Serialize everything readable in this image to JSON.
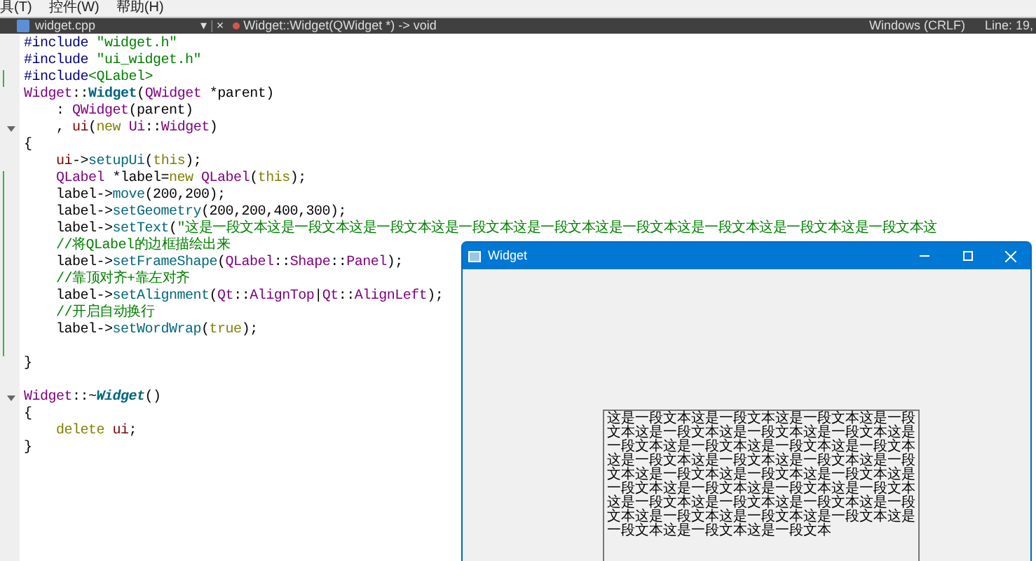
{
  "menu": [
    "具(T)",
    "控件(W)",
    "帮助(H)"
  ],
  "toolbar": {
    "file": "widget.cpp",
    "caret": "▾",
    "separator": "|",
    "close": "×",
    "function": "Widget::Widget(QWidget *) -> void",
    "line_ending": "Windows (CRLF)",
    "position": "Line: 19,"
  },
  "code": [
    {
      "changed": false,
      "fold": false,
      "tokens": [
        {
          "kind": "pre",
          "text": "#include "
        },
        {
          "kind": "str",
          "text": "\"widget.h\""
        }
      ]
    },
    {
      "changed": false,
      "fold": false,
      "tokens": [
        {
          "kind": "pre",
          "text": "#include "
        },
        {
          "kind": "str",
          "text": "\"ui_widget.h\""
        }
      ]
    },
    {
      "changed": true,
      "fold": false,
      "tokens": [
        {
          "kind": "pre",
          "text": "#include"
        },
        {
          "kind": "str",
          "text": "<QLabel>"
        }
      ]
    },
    {
      "changed": false,
      "fold": false,
      "tokens": [
        {
          "kind": "type",
          "text": "Widget"
        },
        {
          "kind": "plain",
          "text": "::"
        },
        {
          "kind": "fn",
          "text": "Widget"
        },
        {
          "kind": "plain",
          "text": "("
        },
        {
          "kind": "type",
          "text": "QWidget"
        },
        {
          "kind": "plain",
          "text": " *parent)"
        }
      ]
    },
    {
      "changed": false,
      "fold": false,
      "tokens": [
        {
          "kind": "plain",
          "text": "    : "
        },
        {
          "kind": "type",
          "text": "QWidget"
        },
        {
          "kind": "plain",
          "text": "(parent)"
        }
      ]
    },
    {
      "changed": false,
      "fold": true,
      "tokens": [
        {
          "kind": "plain",
          "text": "    , "
        },
        {
          "kind": "member",
          "text": "ui"
        },
        {
          "kind": "plain",
          "text": "("
        },
        {
          "kind": "kw",
          "text": "new"
        },
        {
          "kind": "type",
          "text": " Ui"
        },
        {
          "kind": "plain",
          "text": "::"
        },
        {
          "kind": "type",
          "text": "Widget"
        },
        {
          "kind": "plain",
          "text": ")"
        }
      ]
    },
    {
      "changed": false,
      "fold": false,
      "tokens": [
        {
          "kind": "plain",
          "text": "{"
        }
      ]
    },
    {
      "changed": false,
      "fold": false,
      "tokens": [
        {
          "kind": "member",
          "text": "    ui"
        },
        {
          "kind": "plain",
          "text": "->"
        },
        {
          "kind": "method",
          "text": "setupUi"
        },
        {
          "kind": "plain",
          "text": "("
        },
        {
          "kind": "kw",
          "text": "this"
        },
        {
          "kind": "plain",
          "text": ");"
        }
      ]
    },
    {
      "changed": true,
      "fold": false,
      "tokens": [
        {
          "kind": "type",
          "text": "    QLabel"
        },
        {
          "kind": "plain",
          "text": " *label="
        },
        {
          "kind": "kw",
          "text": "new"
        },
        {
          "kind": "type",
          "text": " QLabel"
        },
        {
          "kind": "plain",
          "text": "("
        },
        {
          "kind": "kw",
          "text": "this"
        },
        {
          "kind": "plain",
          "text": ");"
        }
      ]
    },
    {
      "changed": true,
      "fold": false,
      "tokens": [
        {
          "kind": "plain",
          "text": "    label->"
        },
        {
          "kind": "method",
          "text": "move"
        },
        {
          "kind": "plain",
          "text": "(200,200);"
        }
      ]
    },
    {
      "changed": true,
      "fold": false,
      "tokens": [
        {
          "kind": "plain",
          "text": "    label->"
        },
        {
          "kind": "method",
          "text": "setGeometry"
        },
        {
          "kind": "plain",
          "text": "(200,200,400,300);"
        }
      ]
    },
    {
      "changed": true,
      "fold": false,
      "tokens": [
        {
          "kind": "plain",
          "text": "    label->"
        },
        {
          "kind": "method",
          "text": "setText"
        },
        {
          "kind": "plain",
          "text": "("
        },
        {
          "kind": "str",
          "text": "\"这是一段文本这是一段文本这是一段文本这是一段文本这是一段文本这是一段文本这是一段文本这是一段文本这是一段文本这"
        }
      ]
    },
    {
      "changed": true,
      "fold": false,
      "tokens": [
        {
          "kind": "comment",
          "text": "    //将QLabel的边框描绘出来"
        }
      ]
    },
    {
      "changed": true,
      "fold": false,
      "tokens": [
        {
          "kind": "plain",
          "text": "    label->"
        },
        {
          "kind": "method",
          "text": "setFrameShape"
        },
        {
          "kind": "plain",
          "text": "("
        },
        {
          "kind": "type",
          "text": "QLabel"
        },
        {
          "kind": "plain",
          "text": "::"
        },
        {
          "kind": "type",
          "text": "Shape"
        },
        {
          "kind": "plain",
          "text": "::"
        },
        {
          "kind": "type",
          "text": "Panel"
        },
        {
          "kind": "plain",
          "text": ");"
        }
      ]
    },
    {
      "changed": true,
      "fold": false,
      "tokens": [
        {
          "kind": "comment",
          "text": "    //靠顶对齐+靠左对齐"
        }
      ]
    },
    {
      "changed": true,
      "fold": false,
      "tokens": [
        {
          "kind": "plain",
          "text": "    label->"
        },
        {
          "kind": "method",
          "text": "setAlignment"
        },
        {
          "kind": "plain",
          "text": "("
        },
        {
          "kind": "type",
          "text": "Qt"
        },
        {
          "kind": "plain",
          "text": "::"
        },
        {
          "kind": "type",
          "text": "AlignTop"
        },
        {
          "kind": "plain",
          "text": "|"
        },
        {
          "kind": "type",
          "text": "Qt"
        },
        {
          "kind": "plain",
          "text": "::"
        },
        {
          "kind": "type",
          "text": "AlignLeft"
        },
        {
          "kind": "plain",
          "text": ");"
        }
      ]
    },
    {
      "changed": true,
      "fold": false,
      "tokens": [
        {
          "kind": "comment",
          "text": "    //开启自动换行"
        }
      ]
    },
    {
      "changed": true,
      "fold": false,
      "tokens": [
        {
          "kind": "plain",
          "text": "    label->"
        },
        {
          "kind": "method",
          "text": "setWordWrap"
        },
        {
          "kind": "plain",
          "text": "("
        },
        {
          "kind": "kw",
          "text": "true"
        },
        {
          "kind": "plain",
          "text": ");"
        }
      ]
    },
    {
      "changed": true,
      "fold": false
    },
    {
      "changed": false,
      "fold": false,
      "tokens": [
        {
          "kind": "plain",
          "text": "}"
        }
      ]
    },
    {
      "changed": false,
      "fold": false
    },
    {
      "changed": false,
      "fold": true,
      "tokens": [
        {
          "kind": "type",
          "text": "Widget"
        },
        {
          "kind": "plain",
          "text": "::~"
        },
        {
          "kind": "fnital",
          "text": "Widget"
        },
        {
          "kind": "plain",
          "text": "()"
        }
      ]
    },
    {
      "changed": false,
      "fold": false,
      "tokens": [
        {
          "kind": "plain",
          "text": "{"
        }
      ]
    },
    {
      "changed": false,
      "fold": false,
      "tokens": [
        {
          "kind": "kw",
          "text": "    delete"
        },
        {
          "kind": "member",
          "text": " ui"
        },
        {
          "kind": "plain",
          "text": ";"
        }
      ]
    },
    {
      "changed": false,
      "fold": false,
      "tokens": [
        {
          "kind": "plain",
          "text": "}"
        }
      ]
    }
  ],
  "window": {
    "title": "Widget",
    "label_text": "这是一段文本这是一段文本这是一段文本这是一段文本这是一段文本这是一段文本这是一段文本这是一段文本这是一段文本这是一段文本这是一段文本这是一段文本这是一段文本这是一段文本这是一段文本这是一段文本这是一段文本这是一段文本这是一段文本这是一段文本这是一段文本这是一段文本这是一段文本这是一段文本这是一段文本这是一段文本这是一段文本这是一段文本这是一段文本这是一段文本这是一段文本这是一段文本"
  }
}
